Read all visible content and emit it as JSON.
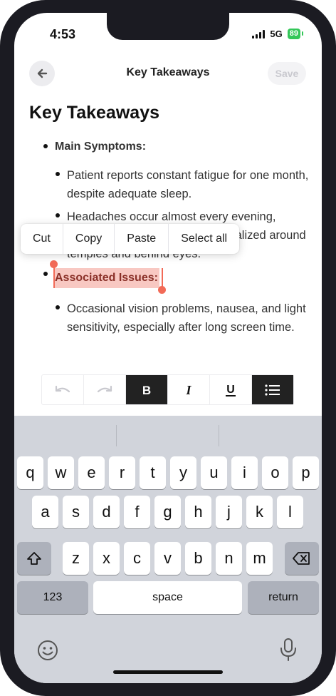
{
  "status_bar": {
    "time": "4:53",
    "network": "5G",
    "battery": "89"
  },
  "nav": {
    "title": "Key Takeaways",
    "save_label": "Save"
  },
  "document": {
    "title": "Key Takeaways",
    "section1_heading": "Main Symptoms:",
    "section1_items": [
      "Patient reports constant fatigue for one month, despite adequate sleep.",
      "Headaches occur almost every evening, usually mild to moderate and localized around temples and behind eyes."
    ],
    "section2_heading": "Associated Issues:",
    "section2_items": [
      "Occasional vision problems, nausea, and light sensitivity, especially after long screen time."
    ]
  },
  "context_menu": {
    "items": [
      "Cut",
      "Copy",
      "Paste",
      "Select all"
    ]
  },
  "toolbar": {
    "icons": [
      "undo-icon",
      "redo-icon",
      "bold-icon",
      "italic-icon",
      "underline-icon",
      "list-icon"
    ],
    "active": [
      "bold",
      "list"
    ]
  },
  "keyboard": {
    "row1": [
      "q",
      "w",
      "e",
      "r",
      "t",
      "y",
      "u",
      "i",
      "o",
      "p"
    ],
    "row2": [
      "a",
      "s",
      "d",
      "f",
      "g",
      "h",
      "j",
      "k",
      "l"
    ],
    "row3": [
      "z",
      "x",
      "c",
      "v",
      "b",
      "n",
      "m"
    ],
    "numbers_label": "123",
    "space_label": "space",
    "return_label": "return"
  },
  "colors": {
    "selection": "#f8c8c2",
    "handle": "#f26a57",
    "battery": "#34c759",
    "toolbar_active": "#222222"
  }
}
